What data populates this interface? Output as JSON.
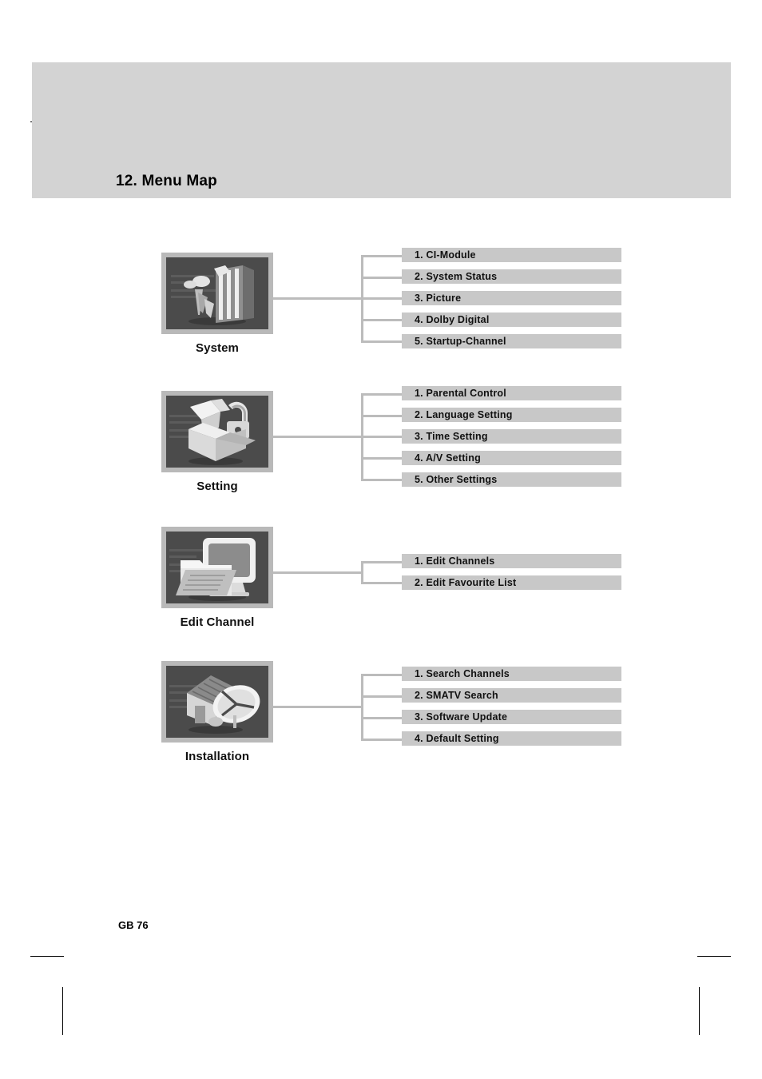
{
  "page": {
    "title": "12. Menu Map",
    "footer": "GB 76"
  },
  "colors": {
    "header_band": "#d3d3d3",
    "item_bar": "#c8c8c8",
    "connector": "#bcbcbc",
    "icon_frame": "#b9b9b9",
    "icon_image": "#4b4b4b",
    "text": "#111111"
  },
  "menu_map": {
    "groups": [
      {
        "caption": "System",
        "icon": "broadcast-tower-icon",
        "items": [
          "1. CI-Module",
          "2. System Status",
          "3. Picture",
          "4. Dolby Digital",
          "5. Startup-Channel"
        ]
      },
      {
        "caption": "Setting",
        "icon": "open-box-lock-icon",
        "items": [
          "1. Parental Control",
          "2. Language Setting",
          "3. Time Setting",
          "4. A/V Setting",
          "5. Other Settings"
        ]
      },
      {
        "caption": "Edit Channel",
        "icon": "tv-folder-icon",
        "items": [
          "1. Edit Channels",
          "2. Edit Favourite List"
        ]
      },
      {
        "caption": "Installation",
        "icon": "house-satellite-dish-icon",
        "items": [
          "1. Search Channels",
          "2. SMATV Search",
          "3. Software Update",
          "4. Default Setting"
        ]
      }
    ]
  }
}
